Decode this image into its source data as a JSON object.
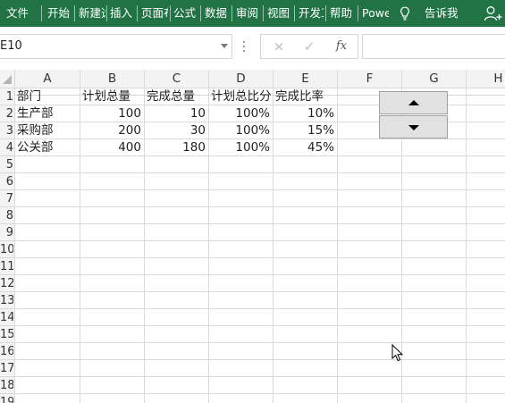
{
  "ribbon": {
    "bg_color": "#217346",
    "tabs": [
      "文件",
      "开始",
      "新建选",
      "插入",
      "页面布",
      "公式",
      "数据",
      "审阅",
      "视图",
      "开发工",
      "帮助",
      "Power"
    ],
    "tell_me": "告诉我"
  },
  "formula_bar": {
    "name_box": "E10",
    "cancel_icon": "×",
    "enter_icon": "✓",
    "fx_icon": "fx",
    "formula": ""
  },
  "sheet": {
    "columns": [
      "A",
      "B",
      "C",
      "D",
      "E",
      "F",
      "G",
      "H"
    ],
    "rows": [
      "1",
      "2",
      "3",
      "4",
      "5",
      "6",
      "7",
      "8",
      "9",
      "10",
      "11",
      "12",
      "13",
      "14",
      "15",
      "16",
      "17",
      "18",
      "19"
    ],
    "header": [
      "部门",
      "计划总量",
      "完成总量",
      "计划总比分",
      "完成比率"
    ],
    "data": [
      [
        "生产部",
        "100",
        "10",
        "100%",
        "10%"
      ],
      [
        "采购部",
        "200",
        "30",
        "100%",
        "15%"
      ],
      [
        "公关部",
        "400",
        "180",
        "100%",
        "45%"
      ]
    ]
  },
  "spin_button": {
    "up_icon": "triangle-up",
    "down_icon": "triangle-down"
  }
}
